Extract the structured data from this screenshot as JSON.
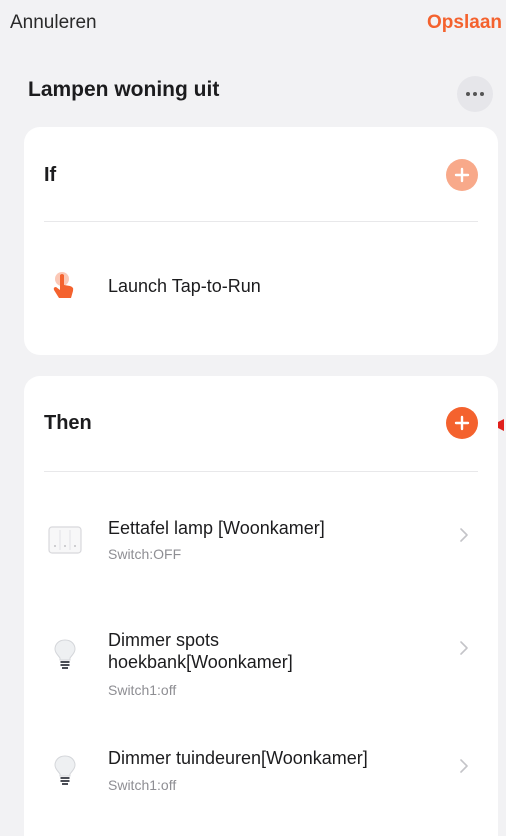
{
  "header": {
    "cancel_label": "Annuleren",
    "save_label": "Opslaan",
    "scene_name": "Lampen woning uit"
  },
  "if_section": {
    "title": "If",
    "conditions": [
      {
        "icon": "tap-to-run-hand-icon",
        "label": "Launch Tap-to-Run"
      }
    ]
  },
  "then_section": {
    "title": "Then",
    "actions": [
      {
        "icon": "wall-switch-icon",
        "title": "Eettafel lamp [Woonkamer]",
        "status": "Switch:OFF"
      },
      {
        "icon": "light-bulb-icon",
        "title_line1": "Dimmer spots",
        "title_line2": "hoekbank[Woonkamer]",
        "status": "Switch1:off"
      },
      {
        "icon": "light-bulb-icon",
        "title": "Dimmer tuindeuren[Woonkamer]",
        "status": "Switch1:off"
      }
    ]
  },
  "colors": {
    "accent": "#f4622e",
    "accent_disabled": "#f8a98a",
    "background": "#f2f2f4",
    "card": "#ffffff",
    "secondary_text": "#8e8e93"
  }
}
